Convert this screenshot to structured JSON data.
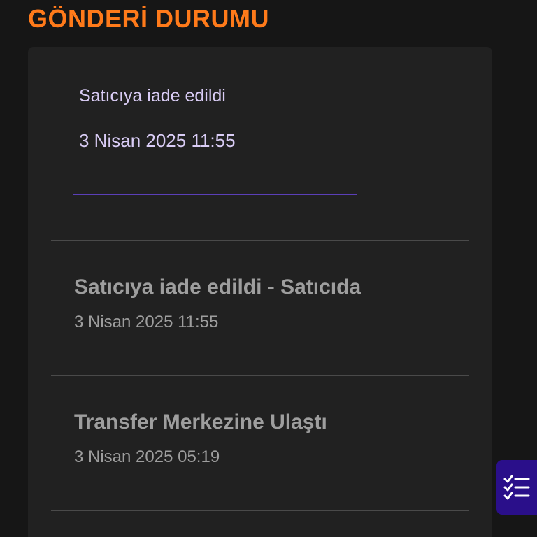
{
  "header": {
    "title": "GÖNDERİ DURUMU"
  },
  "current": {
    "status": "Satıcıya iade edildi",
    "date": "3 Nisan 2025 11:55"
  },
  "history": [
    {
      "status": "Satıcıya iade edildi - Satıcıda",
      "date": "3 Nisan 2025 11:55"
    },
    {
      "status": "Transfer Merkezine Ulaştı",
      "date": "3 Nisan 2025 05:19"
    }
  ],
  "fab": {
    "icon": "checklist-icon"
  },
  "colors": {
    "accent": "#ff7a1a",
    "current_text": "#d9ccf5",
    "accent_line": "#5b3fb8",
    "fab_bg": "#2a0f8a"
  }
}
